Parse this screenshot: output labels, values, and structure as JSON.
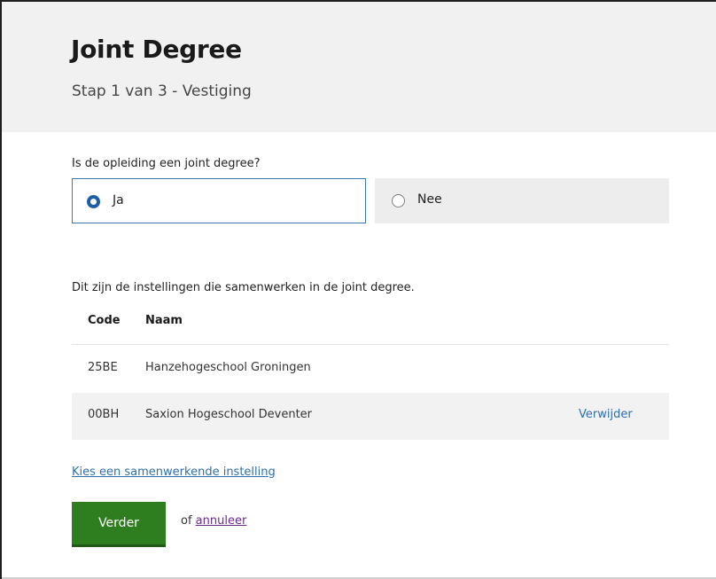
{
  "header": {
    "title": "Joint Degree",
    "subtitle": "Stap 1 van 3 - Vestiging"
  },
  "question": {
    "label": "Is de opleiding een joint degree?",
    "options": [
      {
        "label": "Ja",
        "selected": true
      },
      {
        "label": "Nee",
        "selected": false
      }
    ]
  },
  "institutions": {
    "description": "Dit zijn de instellingen die samenwerken in de joint degree.",
    "columns": {
      "code": "Code",
      "naam": "Naam"
    },
    "rows": [
      {
        "code": "25BE",
        "naam": "Hanzehogeschool Groningen",
        "action": ""
      },
      {
        "code": "00BH",
        "naam": "Saxion Hogeschool Deventer",
        "action": "Verwijder"
      }
    ]
  },
  "actions": {
    "choose_link": "Kies een samenwerkende instelling",
    "next_button": "Verder",
    "or_text": "of",
    "cancel_link": "annuleer"
  },
  "colors": {
    "header_bg": "#f1f1f1",
    "selected_border": "#3b78b8",
    "radio_selected": "#1c5ea6",
    "link": "#2f6fa8",
    "visited_link": "#6a2a8a",
    "primary_button": "#2e7d1f",
    "alt_row": "#f2f2f2"
  }
}
